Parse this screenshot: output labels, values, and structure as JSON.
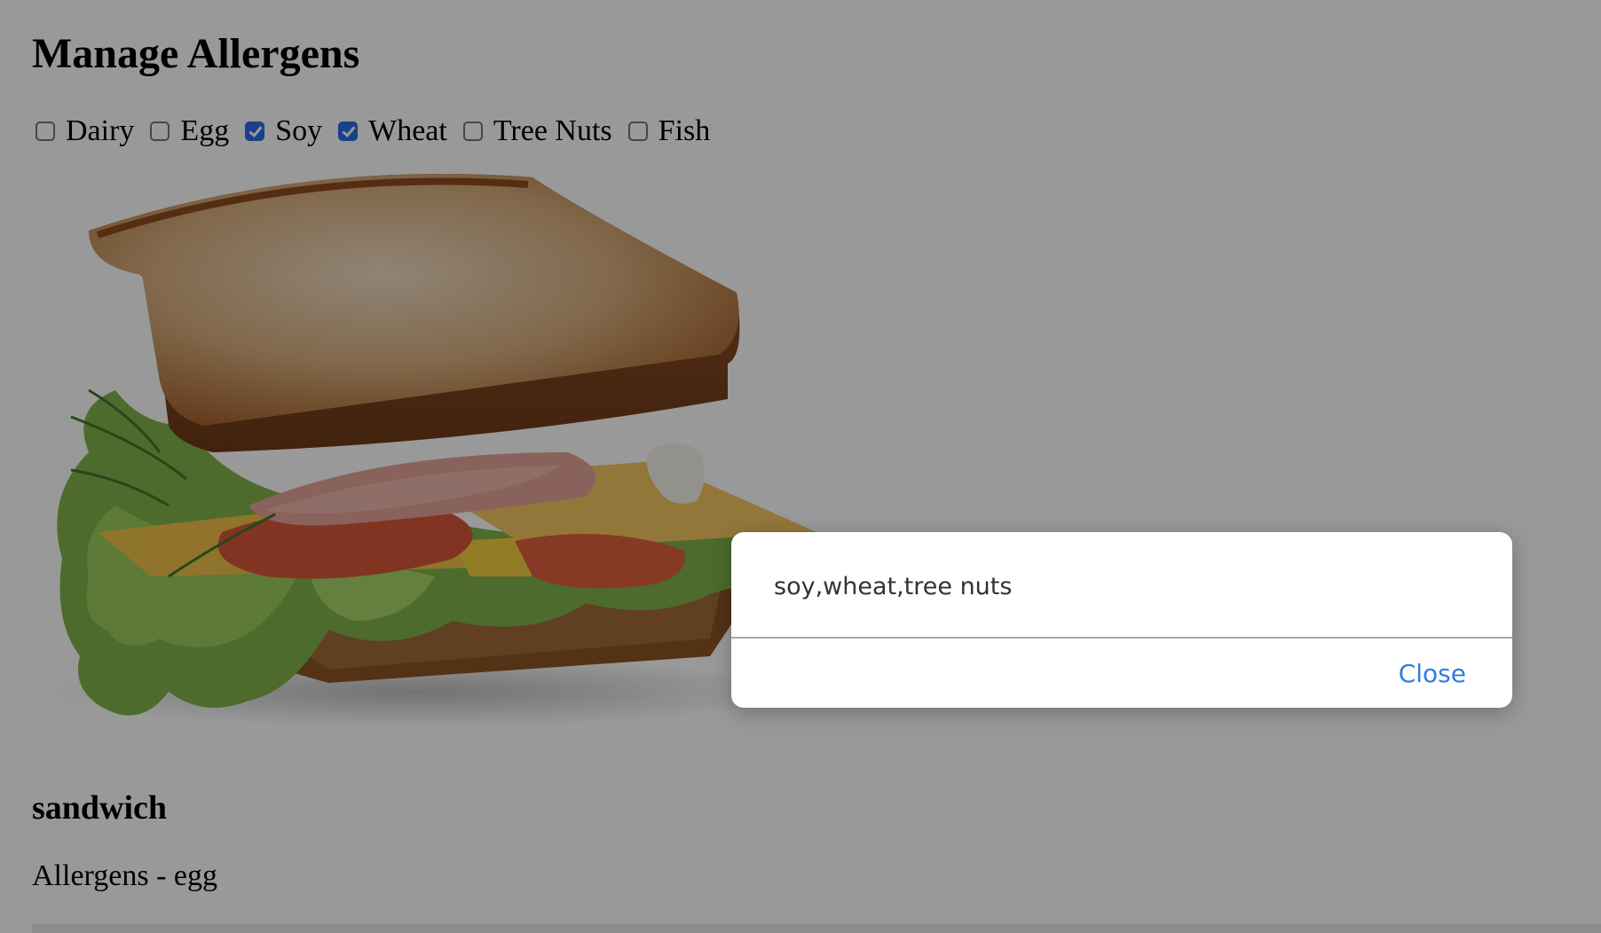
{
  "page": {
    "title": "Manage Allergens"
  },
  "allergens": [
    {
      "label": "Dairy",
      "checked": false
    },
    {
      "label": "Egg",
      "checked": false
    },
    {
      "label": "Soy",
      "checked": true
    },
    {
      "label": "Wheat",
      "checked": true
    },
    {
      "label": "Tree Nuts",
      "checked": false
    },
    {
      "label": "Fish",
      "checked": false
    }
  ],
  "item": {
    "name": "sandwich",
    "allergens_text": "Allergens - egg"
  },
  "dialog": {
    "message": "soy,wheat,tree nuts",
    "close_label": "Close"
  },
  "colors": {
    "checkbox_checked": "#2b6ce8",
    "dialog_button": "#2f7de1",
    "overlay": "rgba(0,0,0,0.4)"
  }
}
